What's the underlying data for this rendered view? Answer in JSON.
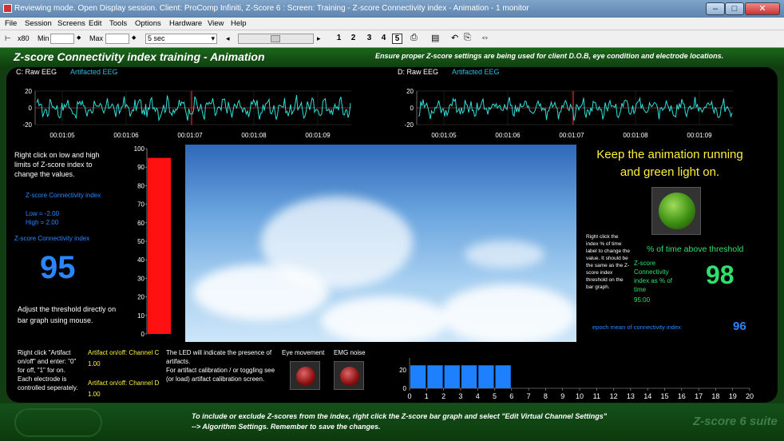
{
  "window": {
    "title": "Reviewing mode. Open Display session. Client: ProComp Infiniti, Z-Score 6 : Screen: Training - Z-score Connectivity index - Animation - 1 monitor",
    "min_glyph": "–",
    "max_glyph": "□",
    "close_glyph": "✕"
  },
  "menu": [
    "File",
    "Session",
    "Screens",
    "Edit",
    "Tools",
    "Options",
    "Hardware",
    "View",
    "Help"
  ],
  "toolbar": {
    "scale_label": "x80",
    "min_label": "Min",
    "max_label": "Max",
    "time_select": "5 sec",
    "left_arrow": "◂",
    "right_arrow": "▸",
    "pages": [
      "1",
      "2",
      "3",
      "4",
      "5"
    ],
    "active_page": "5"
  },
  "header": {
    "title": "Z-score Connectivity index training - Animation",
    "note": "Ensure proper Z-score settings are being used for client D.O.B, eye condition and electrode locations."
  },
  "eeg_left": {
    "channel": "C: Raw EEG",
    "artifact_label": "Artifacted EEG",
    "y_ticks": [
      "20",
      "0",
      "-20"
    ],
    "times": [
      "00:01:05",
      "00:01:06",
      "00:01:07",
      "00:01:08",
      "00:01:09"
    ]
  },
  "eeg_right": {
    "channel": "D: Raw EEG",
    "artifact_label": "Artifacted EEG",
    "y_ticks": [
      "20",
      "0",
      "-20"
    ],
    "times": [
      "00:01:05",
      "00:01:06",
      "00:01:07",
      "00:01:08",
      "00:01:09"
    ]
  },
  "left_info": {
    "instructions": "Right click on low and high limits of Z-score index to change the values.",
    "connectivity_label": "Z-score Connectivity index",
    "low": "Low = -2.00",
    "high": "High = 2.00",
    "index_label": "Z-score Connectivity index",
    "index_value": "95",
    "adjust": "Adjust the threshold directly on bar graph using mouse."
  },
  "bar_graph": {
    "ticks": [
      "100",
      "90",
      "80",
      "70",
      "60",
      "50",
      "40",
      "30",
      "20",
      "10",
      "0"
    ],
    "value_pct": 95,
    "bar_color": "#ff1111"
  },
  "right_info": {
    "keep_running": "Keep the animation running and green light on.",
    "index_note": "Right click the index % of time label to change the value. It should be the same as the Z-score index threshold on the bar graph.",
    "pct_label": "% of time above threshold",
    "pct_desc": "Z-score Connectivity index as % of time",
    "pct_time": "95:00",
    "pct_value": "98",
    "epoch_label": "epoch mean of connectivity index",
    "epoch_value": "96"
  },
  "bottom": {
    "artifact_instr": "Right click \"Artifact on/off\" and enter: \"0\" for off, \"1\" for on. Each electrode is controlled seperately.",
    "artifact_c_label": "Artifact on/off: Channel C",
    "artifact_c_value": "1.00",
    "artifact_d_label": "Artifact on/off: Channel D",
    "artifact_d_value": "1.00",
    "led_note_1": "The LED will indicate the presence of artifacts.",
    "led_note_2": "For artifact calibration / or toggling see (or load) artifact calibration screen.",
    "eye_label": "Eye movement",
    "emg_label": "EMG noise"
  },
  "histogram": {
    "y_tick": "20",
    "y_zero": "0",
    "x_ticks": [
      "0",
      "1",
      "2",
      "3",
      "4",
      "5",
      "6",
      "7",
      "8",
      "9",
      "10",
      "11",
      "12",
      "13",
      "14",
      "15",
      "16",
      "17",
      "18",
      "19",
      "20"
    ],
    "values": [
      25,
      25,
      25,
      25,
      25,
      25
    ],
    "bar_color": "#1e7fff"
  },
  "footer": {
    "note": "To include or exclude Z-scores from the index, right click the Z-score bar graph and select \"Edit Virtual Channel Settings\" --> Algorithm Settings. Remember to save the changes.",
    "suite": "Z-score 6 suite"
  },
  "colors": {
    "accent_green": "#2fe06a",
    "accent_yellow": "#ffef3a",
    "accent_blue": "#2a86ff",
    "eeg_trace": "#2ee0d8"
  }
}
